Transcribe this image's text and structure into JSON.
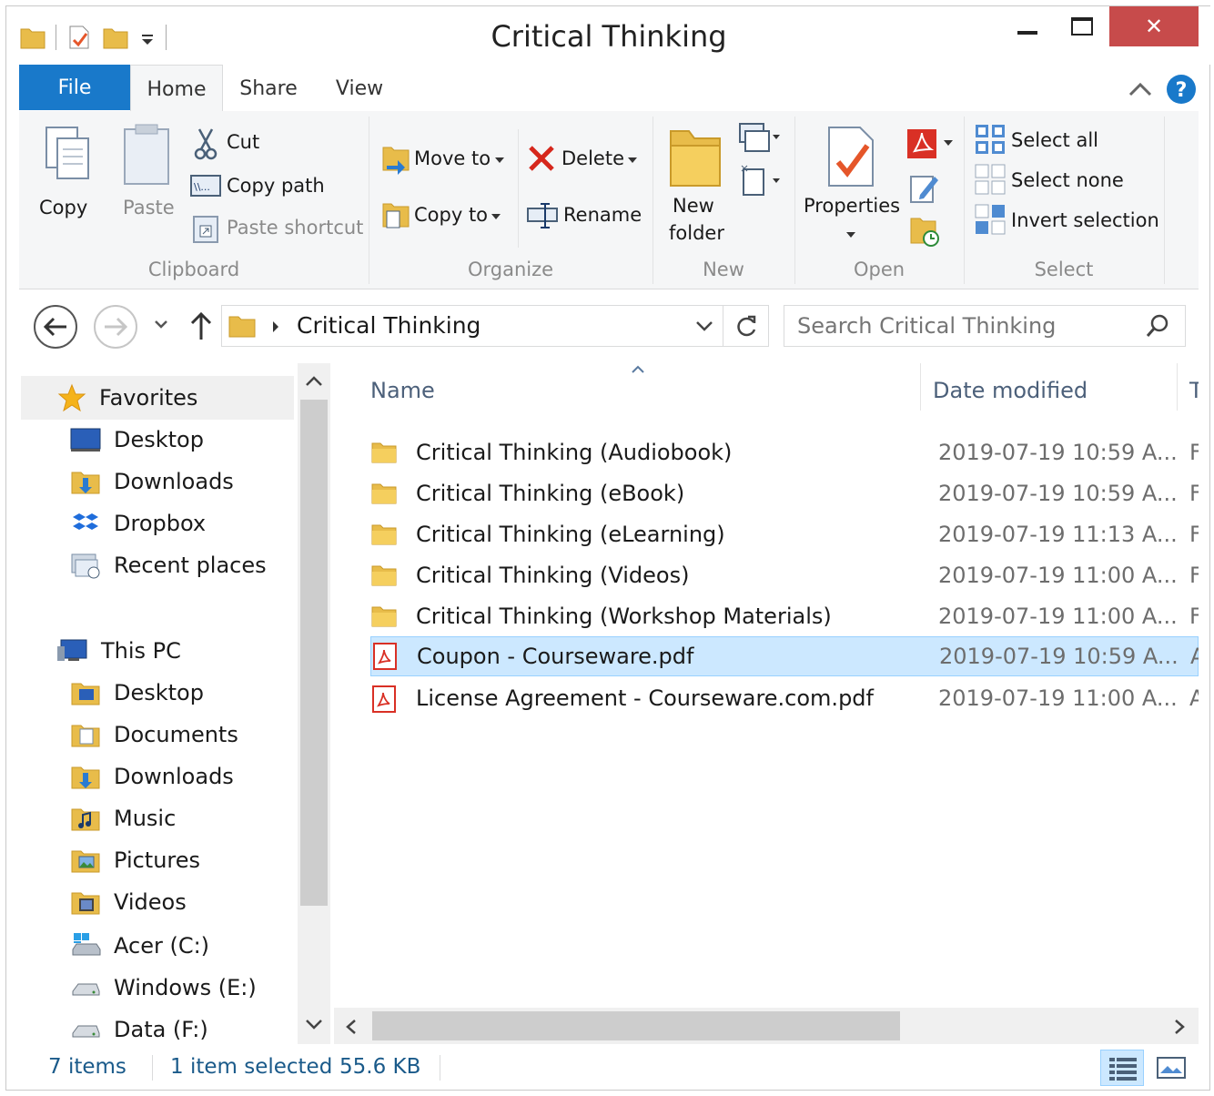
{
  "window": {
    "title": "Critical Thinking",
    "minimize_symbol": "—",
    "maximize_symbol": "☐",
    "close_symbol": "✕"
  },
  "ribbon_tabs": [
    {
      "label": "File",
      "active": false
    },
    {
      "label": "Home",
      "active": true
    },
    {
      "label": "Share",
      "active": false
    },
    {
      "label": "View",
      "active": false
    }
  ],
  "ribbon": {
    "clipboard": {
      "group_label": "Clipboard",
      "copy": "Copy",
      "paste": "Paste",
      "cut": "Cut",
      "copy_path": "Copy path",
      "paste_shortcut": "Paste shortcut"
    },
    "organize": {
      "group_label": "Organize",
      "move_to": "Move to",
      "copy_to": "Copy to",
      "delete": "Delete",
      "rename": "Rename"
    },
    "new": {
      "group_label": "New",
      "new_folder_line1": "New",
      "new_folder_line2": "folder"
    },
    "open": {
      "group_label": "Open",
      "properties": "Properties"
    },
    "select": {
      "group_label": "Select",
      "select_all": "Select all",
      "select_none": "Select none",
      "invert_selection": "Invert selection"
    }
  },
  "address": {
    "path": "Critical Thinking",
    "search_placeholder": "Search Critical Thinking"
  },
  "nav_pane": {
    "favorites": {
      "label": "Favorites",
      "items": [
        "Desktop",
        "Downloads",
        "Dropbox",
        "Recent places"
      ]
    },
    "this_pc": {
      "label": "This PC",
      "items": [
        "Desktop",
        "Documents",
        "Downloads",
        "Music",
        "Pictures",
        "Videos",
        "Acer (C:)",
        "Windows (E:)",
        "Data (F:)"
      ]
    }
  },
  "file_list": {
    "columns": {
      "name": "Name",
      "date": "Date modified",
      "type": "T"
    },
    "rows": [
      {
        "name": "Critical Thinking (Audiobook)",
        "date": "2019-07-19 10:59 A...",
        "type": "F",
        "icon": "folder-icon",
        "selected": false
      },
      {
        "name": "Critical Thinking (eBook)",
        "date": "2019-07-19 10:59 A...",
        "type": "F",
        "icon": "folder-icon",
        "selected": false
      },
      {
        "name": "Critical Thinking (eLearning)",
        "date": "2019-07-19 11:13 A...",
        "type": "F",
        "icon": "folder-icon",
        "selected": false
      },
      {
        "name": "Critical Thinking (Videos)",
        "date": "2019-07-19 11:00 A...",
        "type": "F",
        "icon": "folder-icon",
        "selected": false
      },
      {
        "name": "Critical Thinking (Workshop Materials)",
        "date": "2019-07-19 11:00 A...",
        "type": "F",
        "icon": "folder-icon",
        "selected": false
      },
      {
        "name": "Coupon - Courseware.pdf",
        "date": "2019-07-19 10:59 A...",
        "type": "A",
        "icon": "pdf-icon",
        "selected": true
      },
      {
        "name": "License Agreement - Courseware.com.pdf",
        "date": "2019-07-19 11:00 A...",
        "type": "A",
        "icon": "pdf-icon",
        "selected": false
      }
    ]
  },
  "status": {
    "items_count": "7 items",
    "selected": "1 item selected",
    "size": "55.6 KB"
  },
  "colors": {
    "file_tab": "#1979ca",
    "close_button": "#c74b4b",
    "selection": "#cce8ff",
    "folder": "#e8bc4a",
    "pdf": "#d93025"
  }
}
